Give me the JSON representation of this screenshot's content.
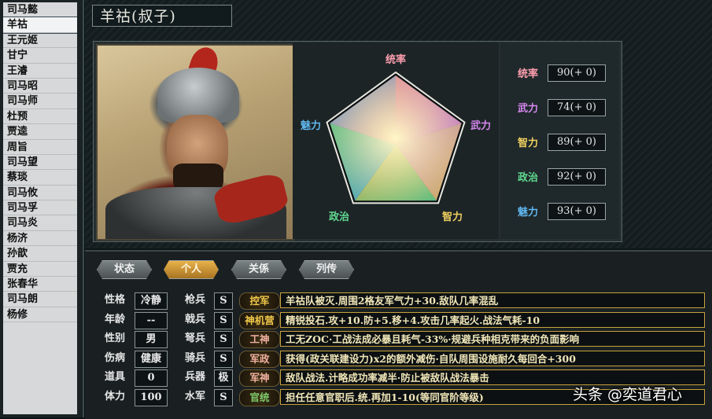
{
  "sidebar": {
    "items": [
      "司马懿",
      "羊祜",
      "王元姬",
      "甘宁",
      "王濬",
      "司马昭",
      "司马师",
      "杜预",
      "贾逵",
      "周旨",
      "司马望",
      "蔡琰",
      "司马攸",
      "司马孚",
      "司马炎",
      "杨济",
      "孙歆",
      "贾充",
      "张春华",
      "司马朗",
      "杨修"
    ],
    "selected_index": 1
  },
  "header": {
    "title": "羊祜(叔子)"
  },
  "radar": {
    "axes": [
      "统率",
      "武力",
      "智力",
      "政治",
      "魅力"
    ],
    "axis_colors": [
      "#ff9fb0",
      "#d888f0",
      "#f0d060",
      "#60d890",
      "#60b8f0"
    ]
  },
  "stats": [
    {
      "label": "统率",
      "value": "90(+ 0)",
      "color": "#ff9fb0",
      "level": 90
    },
    {
      "label": "武力",
      "value": "74(+ 0)",
      "color": "#d888f0",
      "level": 74
    },
    {
      "label": "智力",
      "value": "89(+ 0)",
      "color": "#f0d060",
      "level": 89
    },
    {
      "label": "政治",
      "value": "92(+ 0)",
      "color": "#60d890",
      "level": 92
    },
    {
      "label": "魅力",
      "value": "93(+ 0)",
      "color": "#60b8f0",
      "level": 93
    }
  ],
  "tabs": [
    {
      "label": "状态",
      "active": false
    },
    {
      "label": "个人",
      "active": true
    },
    {
      "label": "关係",
      "active": false
    },
    {
      "label": "列传",
      "active": false
    }
  ],
  "personal": [
    {
      "label": "性格",
      "value": "冷静"
    },
    {
      "label": "年龄",
      "value": "--"
    },
    {
      "label": "性别",
      "value": "男"
    },
    {
      "label": "伤病",
      "value": "健康"
    },
    {
      "label": "道具",
      "value": "0"
    },
    {
      "label": "体力",
      "value": "100"
    }
  ],
  "aptitudes": [
    {
      "label": "枪兵",
      "grade": "S"
    },
    {
      "label": "戟兵",
      "grade": "S"
    },
    {
      "label": "弩兵",
      "grade": "S"
    },
    {
      "label": "骑兵",
      "grade": "S"
    },
    {
      "label": "兵器",
      "grade": "极"
    },
    {
      "label": "水军",
      "grade": "S"
    }
  ],
  "skills": [
    {
      "name": "控军",
      "name_color": "#f0c84a",
      "desc": "羊祜队被灭.周围2格友军气力+30.敌队几率混乱"
    },
    {
      "name": "神机营",
      "name_color": "#f0c84a",
      "desc": "精锐投石.攻+10.防+5.移+4.攻击几率起火.战法气耗-10"
    },
    {
      "name": "工神",
      "name_color": "#f0b0a0",
      "desc": "工无ZOC·工战法成必暴且耗气-33%·规避兵种相克带来的负面影响"
    },
    {
      "name": "军政",
      "name_color": "#f0b0a0",
      "desc": "获得(政关联建设力)x2的额外减伤·自队周围设施耐久每回合+300"
    },
    {
      "name": "军神",
      "name_color": "#f0b0a0",
      "desc": "敌队战法.计略成功率减半·防止被敌队战法暴击"
    },
    {
      "name": "官统",
      "name_color": "#7cc86a",
      "desc": "担任任意官职后.统.再加1-10(等同官阶等级)"
    }
  ],
  "watermark": "头条 @奕道君心",
  "colors": {
    "accent": "#e8b24a",
    "skill_border": "#c6a23c"
  }
}
